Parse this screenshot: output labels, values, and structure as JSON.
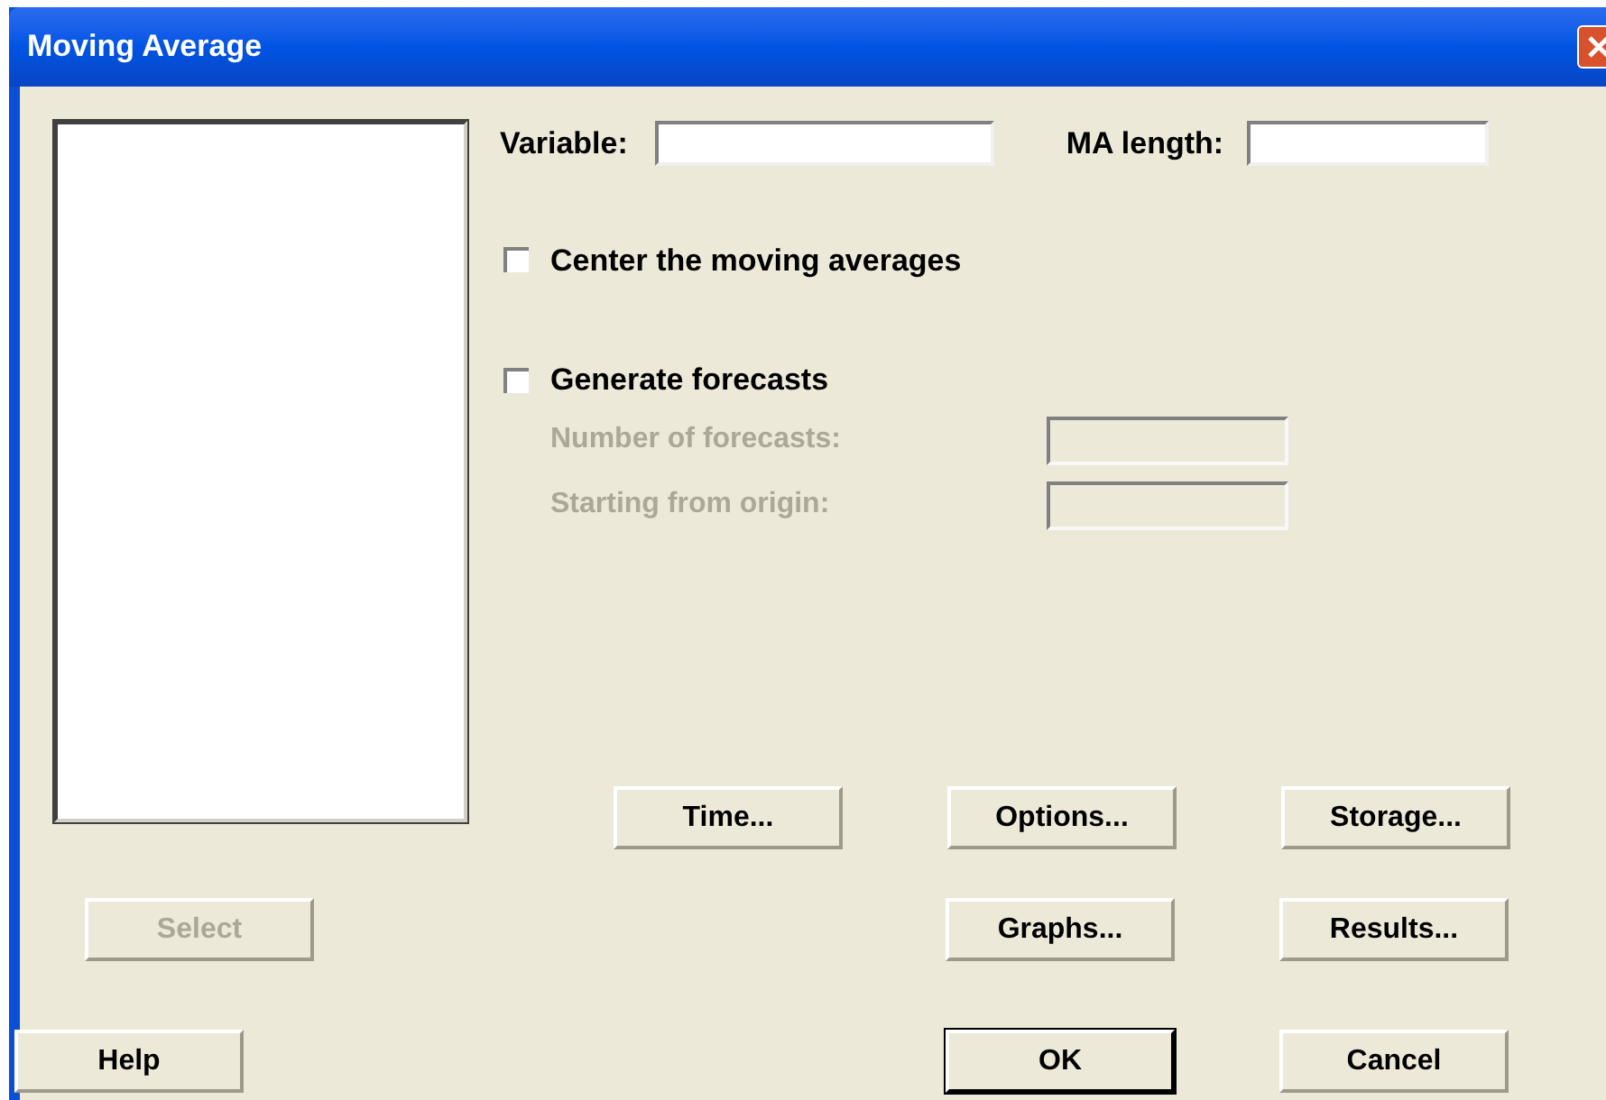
{
  "window": {
    "title": "Moving Average"
  },
  "variable": {
    "label": "Variable:"
  },
  "ma_length": {
    "label": "MA length:"
  },
  "center": {
    "label": "Center the moving averages",
    "checked": false
  },
  "forecast": {
    "label": "Generate forecasts",
    "checked": false
  },
  "forecast_fields": [
    {
      "label": "Number of forecasts:",
      "disabled": true
    },
    {
      "label": "Starting from origin:",
      "disabled": true
    }
  ],
  "button_rows": [
    [
      {
        "label": "Time...",
        "disabled": false,
        "default": false
      },
      {
        "label": "Options...",
        "disabled": false,
        "default": false
      },
      {
        "label": "Storage...",
        "disabled": false,
        "default": false
      }
    ],
    [
      {
        "label": "Select",
        "disabled": true,
        "default": false
      },
      {
        "label": "Graphs...",
        "disabled": false,
        "default": false
      },
      {
        "label": "Results...",
        "disabled": false,
        "default": false
      }
    ],
    [
      {
        "label": "Help",
        "disabled": false,
        "default": false
      },
      {
        "label": "OK",
        "disabled": false,
        "default": true
      },
      {
        "label": "Cancel",
        "disabled": false,
        "default": false
      }
    ]
  ]
}
